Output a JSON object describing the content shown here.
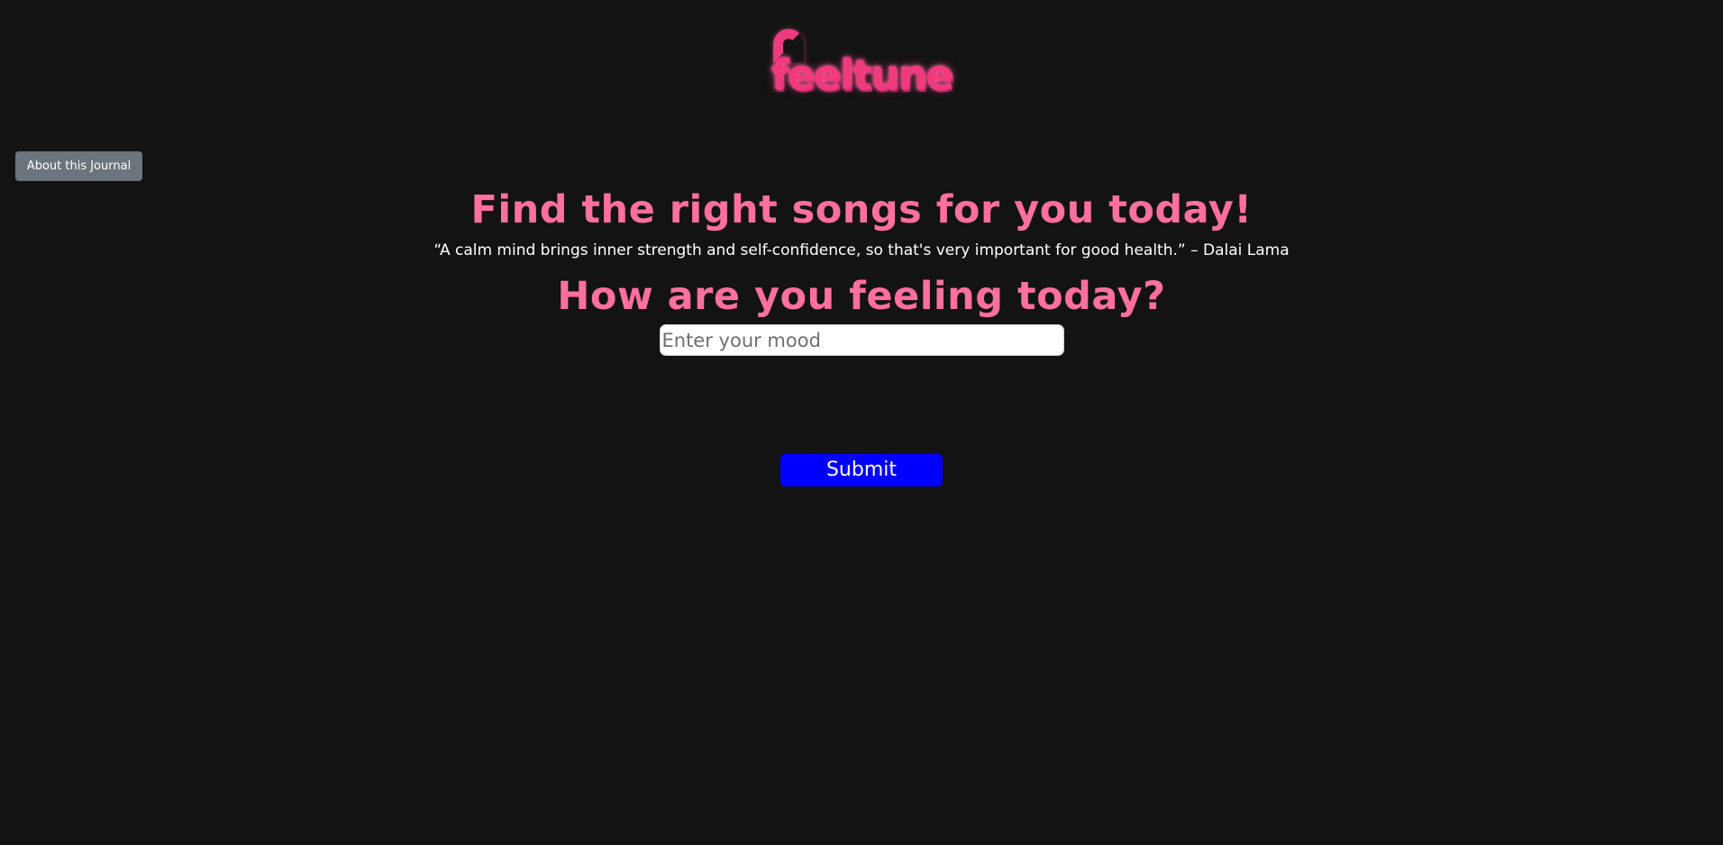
{
  "logo": {
    "text": "feeltune",
    "color": "#f03a7d"
  },
  "about_button": {
    "label": "About this Journal",
    "color": "#6c757d"
  },
  "main": {
    "title": "Find the right songs for you today!",
    "quote": "“A calm mind brings inner strength and self-confidence, so that's very important for good health.” – Dalai Lama",
    "subtitle": "How are you feeling today?",
    "mood_input": {
      "placeholder": "Enter your mood",
      "value": ""
    },
    "submit_label": "Submit",
    "submit_color": "#0000ff"
  },
  "colors": {
    "background": "#131313",
    "heading": "#ff6f9f",
    "text": "#ffffff"
  }
}
